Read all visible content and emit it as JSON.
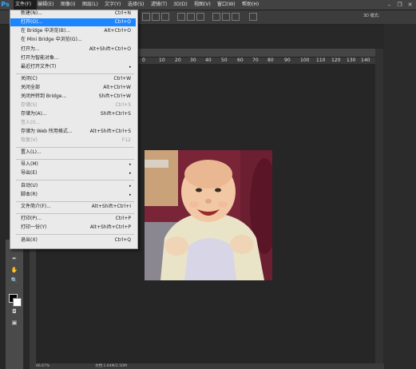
{
  "app": {
    "logo": "Ps"
  },
  "menubar": {
    "items": [
      {
        "label": "文件(F)"
      },
      {
        "label": "编辑(E)"
      },
      {
        "label": "图像(I)"
      },
      {
        "label": "图层(L)"
      },
      {
        "label": "文字(Y)"
      },
      {
        "label": "选择(S)"
      },
      {
        "label": "滤镜(T)"
      },
      {
        "label": "3D(D)"
      },
      {
        "label": "视图(V)"
      },
      {
        "label": "窗口(W)"
      },
      {
        "label": "帮助(H)"
      }
    ],
    "window_buttons": {
      "minimize": "–",
      "restore": "❐",
      "close": "✕"
    }
  },
  "options": {
    "mode_3d": "3D 模式:"
  },
  "ruler": {
    "top_ticks": [
      "0",
      "10",
      "20",
      "30",
      "40",
      "50",
      "60",
      "70",
      "80",
      "90",
      "100",
      "110",
      "120",
      "130",
      "140"
    ]
  },
  "file_menu": {
    "items": [
      {
        "label": "新建(N)...",
        "shortcut": "Ctrl+N"
      },
      {
        "label": "打开(O)...",
        "shortcut": "Ctrl+O"
      },
      {
        "label": "在 Bridge 中浏览(B)...",
        "shortcut": "Alt+Ctrl+O"
      },
      {
        "label": "在 Mini Bridge 中浏览(G)...",
        "shortcut": ""
      },
      {
        "label": "打开为...",
        "shortcut": "Alt+Shift+Ctrl+O"
      },
      {
        "label": "打开为智能对象...",
        "shortcut": ""
      },
      {
        "label": "最近打开文件(T)",
        "shortcut": ""
      },
      {
        "label": "关闭(C)",
        "shortcut": "Ctrl+W"
      },
      {
        "label": "关闭全部",
        "shortcut": "Alt+Ctrl+W"
      },
      {
        "label": "关闭并转到 Bridge...",
        "shortcut": "Shift+Ctrl+W"
      },
      {
        "label": "存储(S)",
        "shortcut": "Ctrl+S"
      },
      {
        "label": "存储为(A)...",
        "shortcut": "Shift+Ctrl+S"
      },
      {
        "label": "签入(I)...",
        "shortcut": ""
      },
      {
        "label": "存储为 Web 所用格式...",
        "shortcut": "Alt+Shift+Ctrl+S"
      },
      {
        "label": "恢复(V)",
        "shortcut": "F12"
      },
      {
        "label": "置入(L)...",
        "shortcut": ""
      },
      {
        "label": "导入(M)",
        "shortcut": ""
      },
      {
        "label": "导出(E)",
        "shortcut": ""
      },
      {
        "label": "自动(U)",
        "shortcut": ""
      },
      {
        "label": "脚本(R)",
        "shortcut": ""
      },
      {
        "label": "文件简介(F)...",
        "shortcut": "Alt+Shift+Ctrl+I"
      },
      {
        "label": "打印(P)...",
        "shortcut": "Ctrl+P"
      },
      {
        "label": "打印一份(Y)",
        "shortcut": "Alt+Shift+Ctrl+P"
      },
      {
        "label": "退出(X)",
        "shortcut": "Ctrl+Q"
      }
    ],
    "submenu_arrow": "▸"
  },
  "status": {
    "zoom": "66.67%",
    "doc": "文档:1.64M/2.50M"
  },
  "colors": {
    "highlight": "#1c86ff",
    "menu_bg": "#eaeaea",
    "app_bg": "#282828",
    "accent": "#31a8ff"
  }
}
